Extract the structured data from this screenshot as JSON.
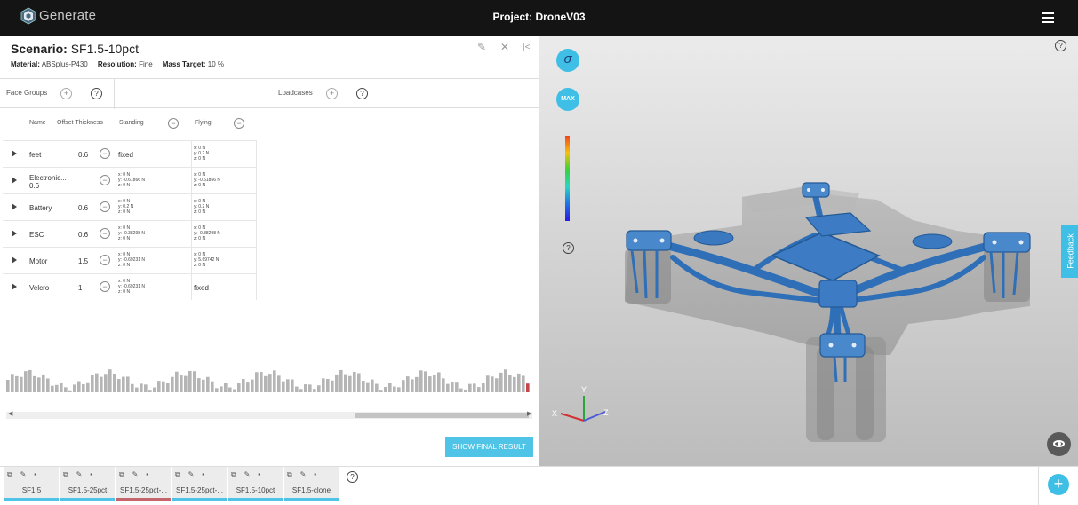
{
  "app": {
    "name": "Generate",
    "project_title": "Project: DroneV03"
  },
  "scenario": {
    "title_label": "Scenario:",
    "title_value": "SF1.5-10pct",
    "material_label": "Material:",
    "material_value": "ABSplus-P430",
    "resolution_label": "Resolution:",
    "resolution_value": "Fine",
    "mass_label": "Mass Target:",
    "mass_value": "10 %"
  },
  "icons": {
    "edit": "pencil-icon",
    "close": "close-icon",
    "collapse": "collapse-icon",
    "menu": "hamburger-icon"
  },
  "panels": {
    "face_groups": "Face Groups",
    "loadcases": "Loadcases"
  },
  "table": {
    "headers": {
      "name": "Name",
      "offset": "Offset Thickness",
      "standing": "Standing",
      "flying": "Flying"
    },
    "rows": [
      {
        "name": "feet",
        "name2": "",
        "offset": "0.6",
        "standing": [
          "fixed"
        ],
        "flying": [
          "x: 0 N",
          "y: 0.2 N",
          "z: 0 N"
        ]
      },
      {
        "name": "Electronic...",
        "name2": "0.6",
        "offset": "",
        "standing": [
          "x: 0 N",
          "y: -0.61866 N",
          "z: 0 N"
        ],
        "flying": [
          "x: 0 N",
          "y: -0.61866 N",
          "z: 0 N"
        ]
      },
      {
        "name": "Battery",
        "name2": "",
        "offset": "0.6",
        "standing": [
          "x: 0 N",
          "y: 0.2 N",
          "z: 0 N"
        ],
        "flying": [
          "x: 0 N",
          "y: 0.2 N",
          "z: 0 N"
        ]
      },
      {
        "name": "ESC",
        "name2": "",
        "offset": "0.6",
        "standing": [
          "x: 0 N",
          "y: -0.38298 N",
          "z: 0 N"
        ],
        "flying": [
          "x: 0 N",
          "y: -0.38298 N",
          "z: 0 N"
        ]
      },
      {
        "name": "Motor",
        "name2": "",
        "offset": "1.5",
        "standing": [
          "x: 0 N",
          "y: -0.69231 N",
          "z: 0 N"
        ],
        "flying": [
          "x: 0 N",
          "y: 5.69742 N",
          "z: 0 N"
        ]
      },
      {
        "name": "Velcro",
        "name2": "",
        "offset": "1",
        "standing": [
          "x: 0 N",
          "y: -0.69231 N",
          "z: 0 N"
        ],
        "flying": [
          "fixed"
        ]
      }
    ]
  },
  "actions": {
    "show_final": "SHOW FINAL RESULT",
    "sigma": "σ",
    "max": "MAX",
    "feedback": "Feedback",
    "help": "?"
  },
  "axes": {
    "x": "X",
    "y": "Y",
    "z": "Z"
  },
  "colors": {
    "accent": "#4fc4e6",
    "active_tab": "#c4646b"
  },
  "scenario_tabs": [
    {
      "label": "SF1.5",
      "active": false
    },
    {
      "label": "SF1.5-25pct",
      "active": false
    },
    {
      "label": "SF1.5-25pct-...",
      "active": true
    },
    {
      "label": "SF1.5-25pct-...",
      "active": false
    },
    {
      "label": "SF1.5-10pct",
      "active": false
    },
    {
      "label": "SF1.5-clone",
      "active": false
    }
  ]
}
